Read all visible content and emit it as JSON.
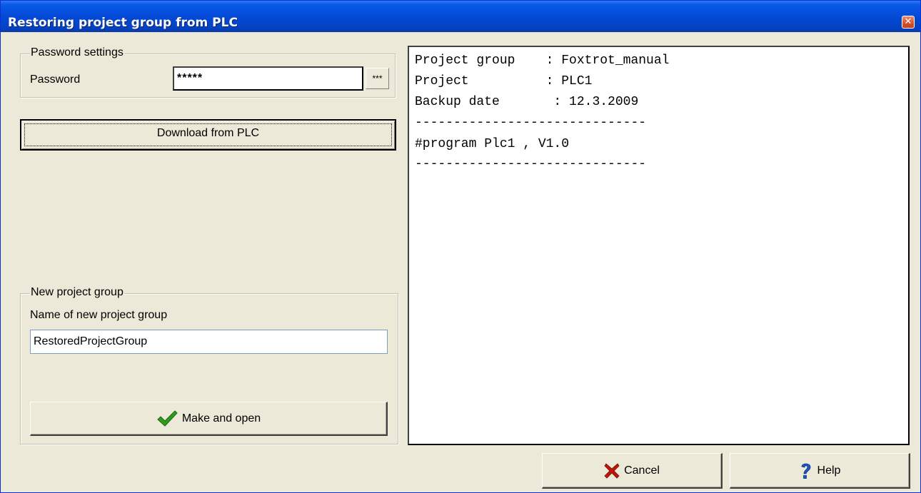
{
  "window": {
    "title": "Restoring project group from PLC",
    "close_glyph": "✕"
  },
  "password_settings": {
    "legend": "Password settings",
    "password_label": "Password",
    "password_value": "*****",
    "show_button_label": "***"
  },
  "download_button": {
    "label": "Download from PLC"
  },
  "new_project_group": {
    "legend": "New project group",
    "name_label": "Name of new project group",
    "name_value": "RestoredProjectGroup",
    "make_button_label": "Make and open",
    "make_button_icon": "checkmark-icon"
  },
  "output": {
    "lines": [
      "Project group    : Foxtrot_manual",
      "Project          : PLC1",
      "Backup date       : 12.3.2009",
      "------------------------------",
      "#program Plc1 , V1.0",
      "------------------------------"
    ]
  },
  "footer": {
    "cancel_label": "Cancel",
    "cancel_icon": "x-cancel-icon",
    "help_label": "Help",
    "help_icon": "question-icon"
  },
  "colors": {
    "titlebar": "#0348d4",
    "dialog_bg": "#ece9d8",
    "check_green": "#2e9a1e",
    "cancel_red": "#c0160a",
    "help_blue": "#1d56c9"
  }
}
